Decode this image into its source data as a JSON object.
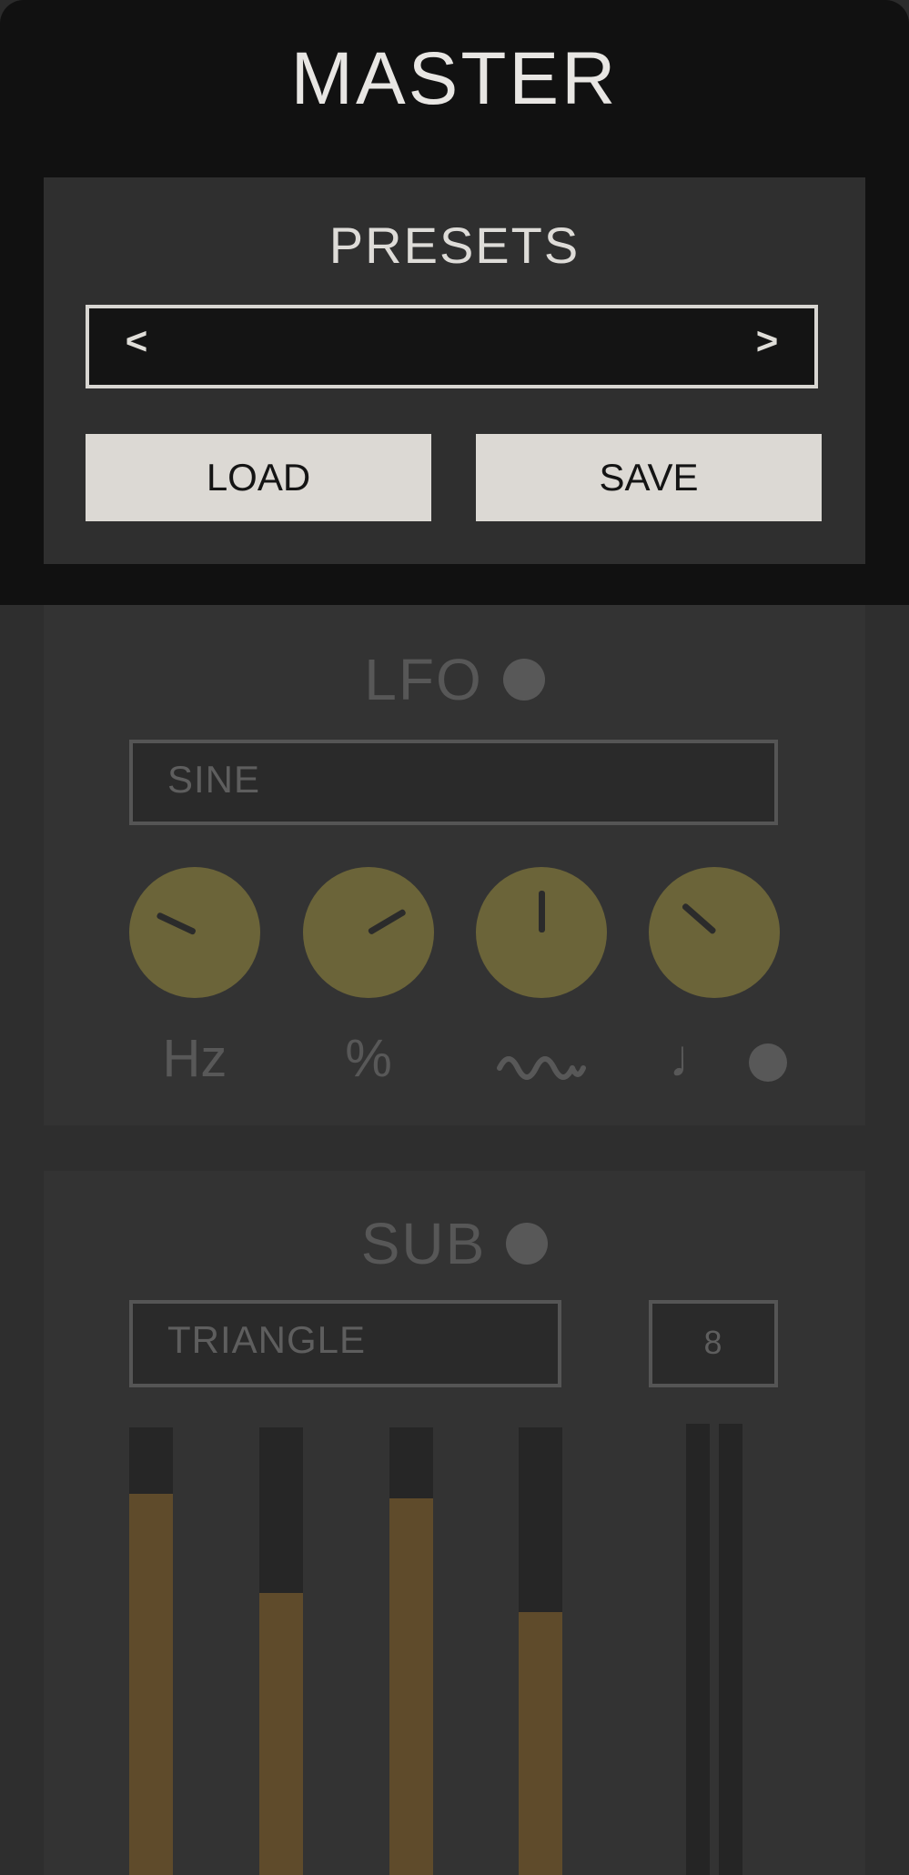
{
  "master": {
    "title": "MASTER"
  },
  "presets": {
    "title": "PRESETS",
    "prev_label": "<",
    "next_label": ">",
    "current_preset": "",
    "load_label": "LOAD",
    "save_label": "SAVE"
  },
  "lfo": {
    "title": "LFO",
    "waveform": "SINE",
    "knobs": [
      {
        "name": "rate",
        "label": "Hz",
        "value": 0.26
      },
      {
        "name": "amount",
        "label": "%",
        "value": 0.72
      },
      {
        "name": "shape",
        "label": "wave",
        "value": 0.5
      },
      {
        "name": "sync",
        "label": "♩",
        "value": 0.32
      }
    ]
  },
  "sub": {
    "title": "SUB",
    "waveform": "TRIANGLE",
    "octave": "8",
    "sliders": [
      0.86,
      0.65,
      0.85,
      0.61
    ]
  },
  "colors": {
    "background": "#111111",
    "panel": "#2f2f2f",
    "knob": "#6b6439",
    "slider_fill": "#5f4b2b",
    "button": "#dcd9d4",
    "muted_text": "#585858"
  }
}
